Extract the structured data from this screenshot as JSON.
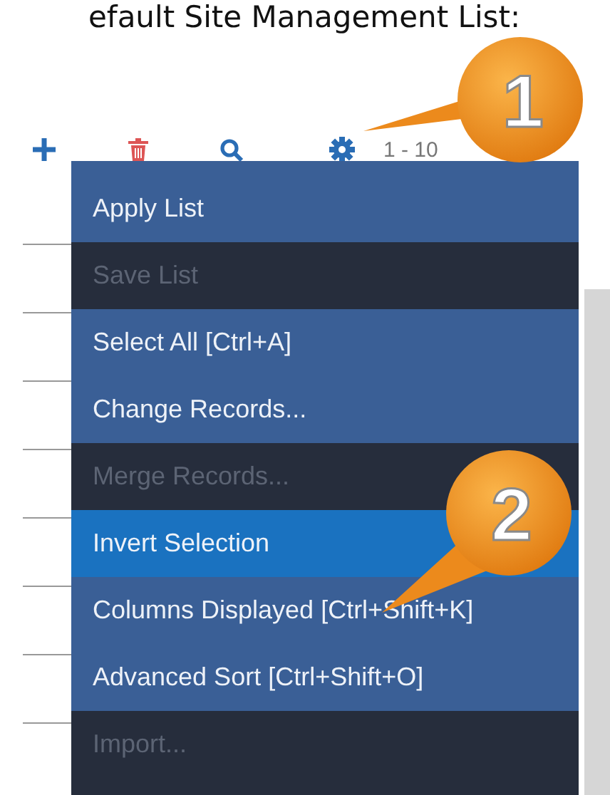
{
  "heading": "efault Site Management List:",
  "toolbar": {
    "pager": "1 - 10"
  },
  "menu": [
    {
      "label": "Apply List",
      "disabled": false,
      "selected": false
    },
    {
      "label": "Save List",
      "disabled": true,
      "selected": false
    },
    {
      "label": "Select All [Ctrl+A]",
      "disabled": false,
      "selected": false
    },
    {
      "label": "Change Records...",
      "disabled": false,
      "selected": false
    },
    {
      "label": "Merge Records...",
      "disabled": true,
      "selected": false
    },
    {
      "label": "Invert Selection",
      "disabled": false,
      "selected": true
    },
    {
      "label": "Columns Displayed [Ctrl+Shift+K]",
      "disabled": false,
      "selected": false
    },
    {
      "label": "Advanced Sort [Ctrl+Shift+O]",
      "disabled": false,
      "selected": false
    },
    {
      "label": "Import...",
      "disabled": true,
      "selected": false
    }
  ],
  "callouts": [
    {
      "label": "1"
    },
    {
      "label": "2"
    }
  ]
}
